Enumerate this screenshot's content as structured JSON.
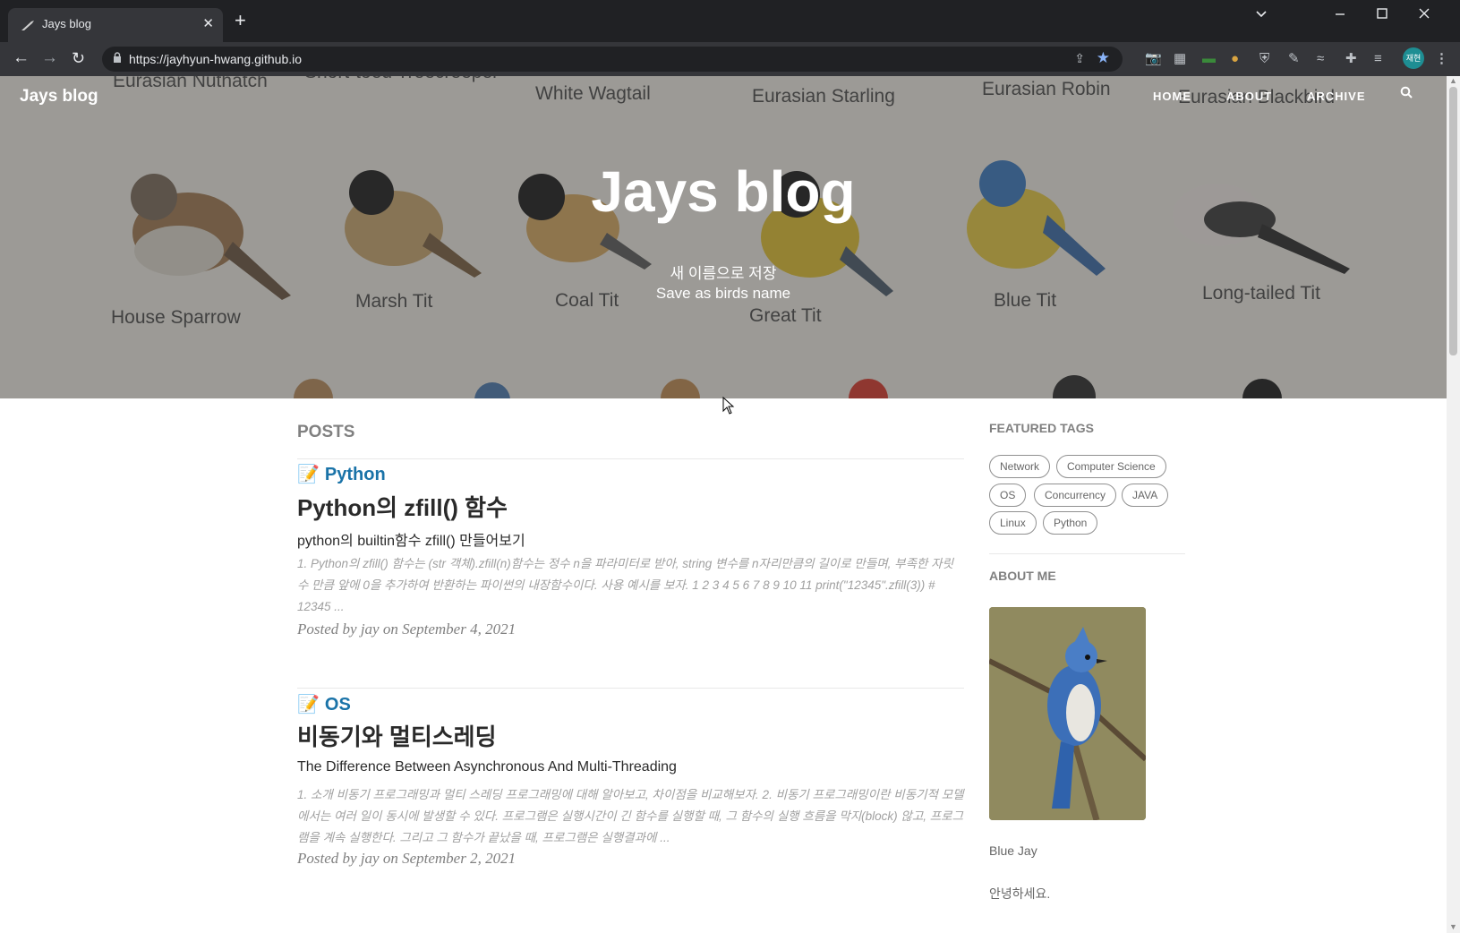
{
  "browser": {
    "tab_title": "Jays blog",
    "url": "https://jayhyun-hwang.github.io",
    "profile_label": "재현"
  },
  "site": {
    "brand": "Jays blog",
    "nav": [
      "HOME",
      "ABOUT",
      "ARCHIVE"
    ]
  },
  "hero": {
    "title": "Jays blog",
    "subtitle_ko": "새 이름으로 저장",
    "subtitle_en": "Save as birds name",
    "bird_labels": [
      "Eurasian Nuthatch",
      "Short-toed Treecreeper",
      "White Wagtail",
      "Eurasian Starling",
      "Eurasian Robin",
      "Eurasian Blackbird",
      "House Sparrow",
      "Marsh Tit",
      "Coal Tit",
      "Great Tit",
      "Blue Tit",
      "Long-tailed Tit"
    ]
  },
  "posts": {
    "heading": "POSTS",
    "items": [
      {
        "category": "Python",
        "title": "Python의 zfill() 함수",
        "subtitle": "python의 builtin함수 zfill() 만들어보기",
        "excerpt": "1. Python의 zfill() 함수는 (str 객체).zfill(n)함수는 정수 n을 파라미터로 받아, string 변수를 n자리만큼의 길이로 만들며, 부족한 자릿수 만큼 앞에 0을 추가하여 반환하는 파이썬의 내장함수이다. 사용 예시를 보자. 1 2 3 4 5 6 7 8 9 10 11 print(\"12345\".zfill(3)) # 12345 ...",
        "meta": "Posted by jay on September 4, 2021"
      },
      {
        "category": "OS",
        "title": "비동기와 멀티스레딩",
        "subtitle": "The Difference Between Asynchronous And Multi-Threading",
        "excerpt": "1. 소개 비동기 프로그래밍과 멀티 스레딩 프로그래밍에 대해 알아보고, 차이점을 비교해보자. 2. 비동기 프로그래밍이란 비동기적 모델에서는 여러 일이 동시에 발생할 수 있다. 프로그램은 실행시간이 긴 함수를 실행할 때, 그 함수의 실행 흐름을 막지(block) 않고, 프로그램을 계속 실행한다. 그리고 그 함수가 끝났을 때, 프로그램은 실행결과에 ...",
        "meta": "Posted by jay on September 2, 2021"
      }
    ]
  },
  "sidebar": {
    "featured_tags_heading": "FEATURED TAGS",
    "tags": [
      "Network",
      "Computer Science",
      "OS",
      "Concurrency",
      "JAVA",
      "Linux",
      "Python"
    ],
    "about_heading": "ABOUT ME",
    "photo_caption": "Blue Jay",
    "about_text": "안녕하세요."
  }
}
